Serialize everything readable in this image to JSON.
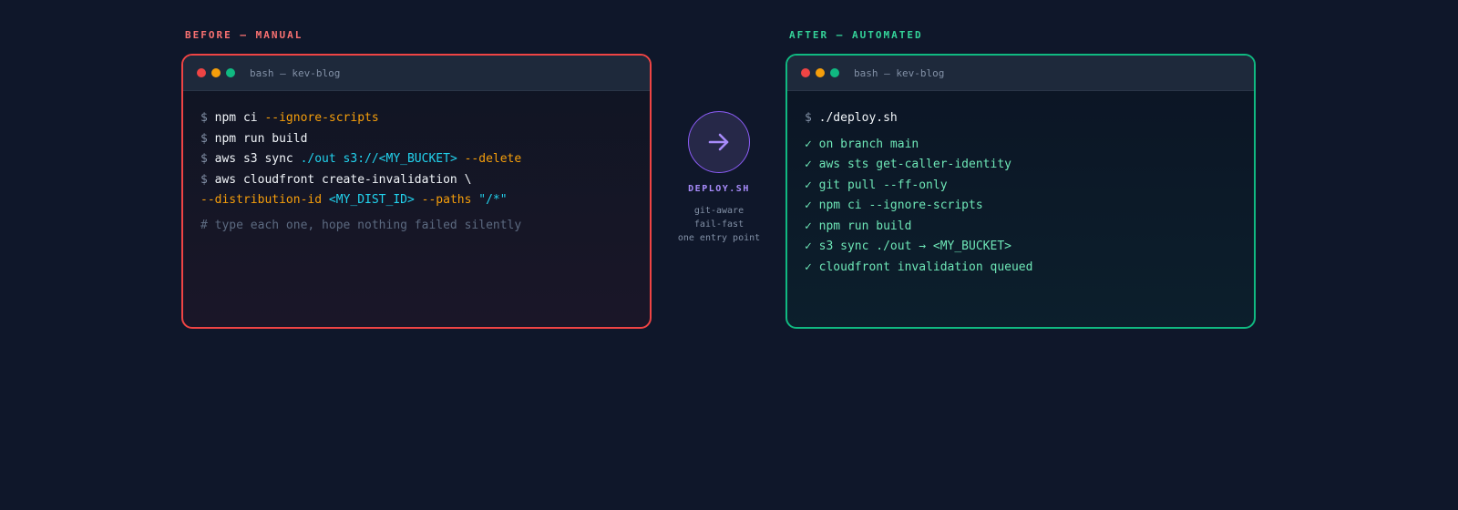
{
  "before": {
    "section_label": "BEFORE — MANUAL",
    "window_title": "bash — kev-blog",
    "lines": {
      "l1": {
        "prompt": "$",
        "cmd": "npm ci",
        "flag": "--ignore-scripts"
      },
      "l2": {
        "prompt": "$",
        "cmd": "npm run build"
      },
      "l3": {
        "prompt": "$",
        "cmd": "aws s3 sync",
        "path": "./out s3://<MY_BUCKET>",
        "flag": "--delete"
      },
      "l4": {
        "prompt": "$",
        "cmd": "aws cloudfront create-invalidation \\"
      },
      "l5": {
        "flag1": "--distribution-id",
        "arg1": "<MY_DIST_ID>",
        "flag2": "--paths",
        "arg2": "\"/*\""
      }
    },
    "comment": "# type each one, hope nothing failed silently"
  },
  "middle": {
    "arrow_label": "DEPLOY.SH",
    "features": [
      "git-aware",
      "fail-fast",
      "one entry point"
    ]
  },
  "after": {
    "section_label": "AFTER — AUTOMATED",
    "window_title": "bash — kev-blog",
    "command": {
      "prompt": "$",
      "text": "./deploy.sh"
    },
    "checks": [
      "✓ on branch main",
      "✓ aws sts get-caller-identity",
      "✓ git pull --ff-only",
      "✓ npm ci --ignore-scripts",
      "✓ npm run build",
      "✓ s3 sync ./out → <MY_BUCKET>",
      "✓ cloudfront invalidation queued"
    ]
  },
  "colors": {
    "background": "#0f172a",
    "before_accent": "#ef4444",
    "after_accent": "#10b981",
    "middle_accent": "#8b5cf6",
    "flag": "#f59e0b",
    "path": "#22d3ee"
  }
}
